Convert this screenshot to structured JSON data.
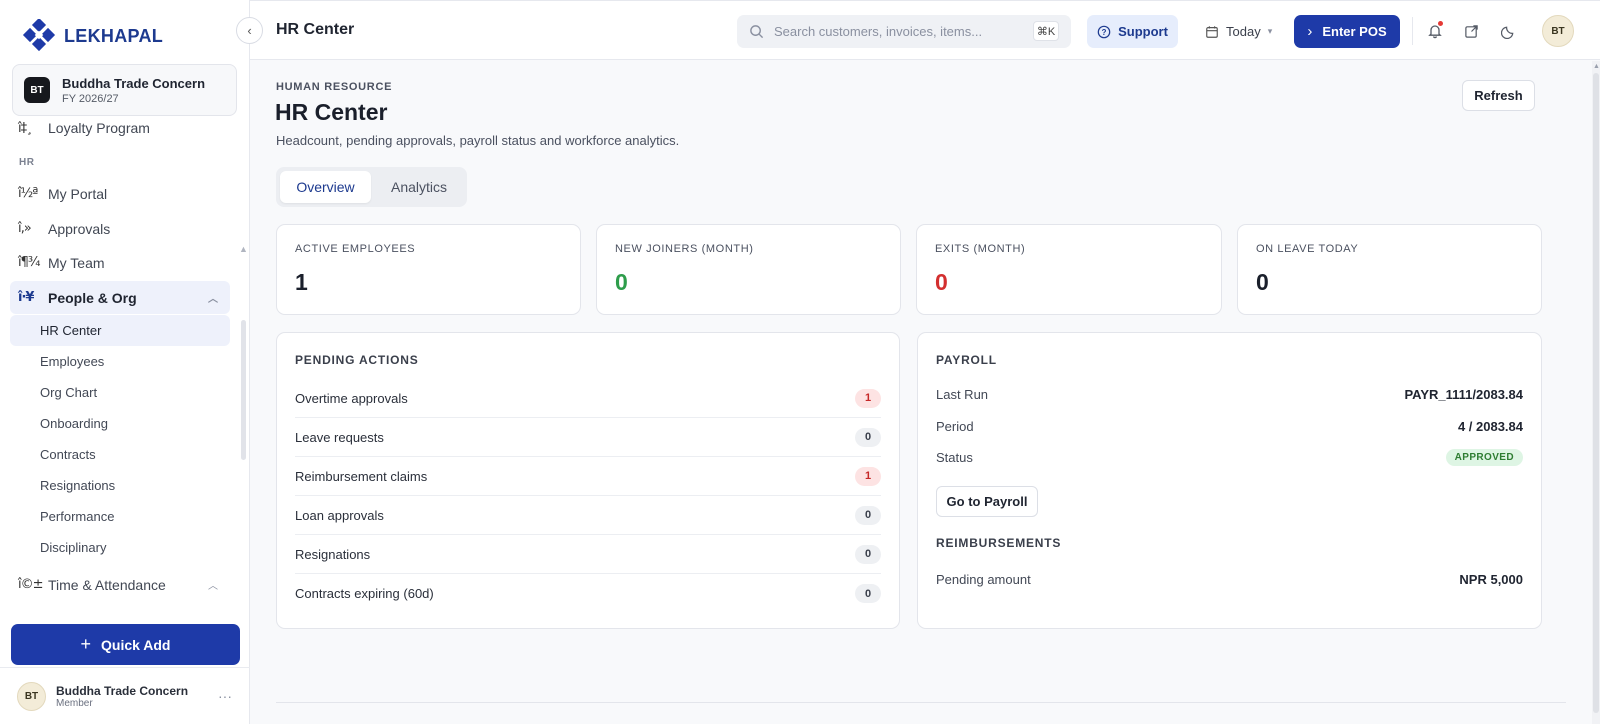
{
  "brand": {
    "name": "LEKHAPAL",
    "colors": {
      "primary": "#1e3aa8",
      "brand_text": "#1d3a8f"
    }
  },
  "org": {
    "initials": "BT",
    "name": "Buddha Trade Concern",
    "fy": "FY 2026/27"
  },
  "sidebar": {
    "partial_item": {
      "glyph": "î‡¸",
      "label": "Loyalty Program"
    },
    "section_hr": "HR",
    "items": [
      {
        "glyph": "î½ª",
        "label": "My Portal"
      },
      {
        "glyph": "î‚»",
        "label": "Approvals"
      },
      {
        "glyph": "î¶¾",
        "label": "My Team"
      },
      {
        "glyph": "î·¥",
        "label": "People & Org"
      },
      {
        "glyph": "î©±",
        "label": "Time & Attendance"
      }
    ],
    "sub_items": [
      "HR Center",
      "Employees",
      "Org Chart",
      "Onboarding",
      "Contracts",
      "Resignations",
      "Performance",
      "Disciplinary"
    ],
    "quick_add": "Quick Add",
    "user": {
      "initials": "BT",
      "name": "Buddha Trade Concern",
      "role": "Member"
    }
  },
  "topbar": {
    "title": "HR Center",
    "search_placeholder": "Search customers, invoices, items...",
    "search_shortcut": "⌘K",
    "support": "Support",
    "date_filter": "Today",
    "enter_pos": "Enter POS",
    "avatar": "BT"
  },
  "page": {
    "eyebrow": "HUMAN RESOURCE",
    "title": "HR Center",
    "subtitle": "Headcount, pending approvals, payroll status and workforce analytics.",
    "refresh": "Refresh",
    "tabs": [
      "Overview",
      "Analytics"
    ]
  },
  "kpis": [
    {
      "label": "ACTIVE EMPLOYEES",
      "value": "1",
      "color": "#1a1f2b"
    },
    {
      "label": "NEW JOINERS (MONTH)",
      "value": "0",
      "color": "#2e9d4b"
    },
    {
      "label": "EXITS (MONTH)",
      "value": "0",
      "color": "#d32f2f"
    },
    {
      "label": "ON LEAVE TODAY",
      "value": "0",
      "color": "#1a1f2b"
    }
  ],
  "pending_actions": {
    "title": "PENDING ACTIONS",
    "rows": [
      {
        "label": "Overtime approvals",
        "count": "1",
        "level": "warn"
      },
      {
        "label": "Leave requests",
        "count": "0",
        "level": "neutral"
      },
      {
        "label": "Reimbursement claims",
        "count": "1",
        "level": "warn"
      },
      {
        "label": "Loan approvals",
        "count": "0",
        "level": "neutral"
      },
      {
        "label": "Resignations",
        "count": "0",
        "level": "neutral"
      },
      {
        "label": "Contracts expiring (60d)",
        "count": "0",
        "level": "neutral"
      }
    ]
  },
  "payroll": {
    "title": "PAYROLL",
    "last_run_label": "Last Run",
    "last_run": "PAYR_1111/2083.84",
    "period_label": "Period",
    "period": "4 / 2083.84",
    "status_label": "Status",
    "status": "APPROVED",
    "goto": "Go to Payroll",
    "reimb_title": "REIMBURSEMENTS",
    "pending_label": "Pending amount",
    "pending_amount": "NPR 5,000"
  }
}
